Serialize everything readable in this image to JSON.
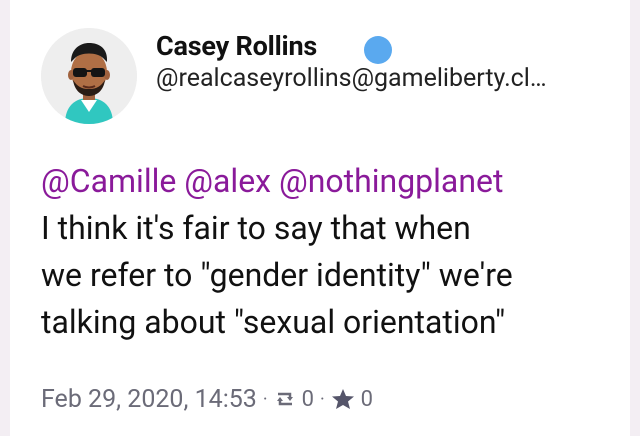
{
  "post": {
    "author": {
      "name": "Casey Rollins",
      "handle": "@realcaseyrollins@gameliberty.cl…",
      "avatar_icon": "bitmoji-avatar-icon",
      "verified_icon": "verified-badge-icon"
    },
    "mentions": [
      "@Camille",
      "@alex",
      "@nothingplanet"
    ],
    "body_lines": [
      "I think it's fair to say that when",
      "we refer to \"gender identity\" we're",
      "talking about \"sexual orientation\""
    ],
    "meta": {
      "timestamp": "Feb 29, 2020, 14:53",
      "separator": "·",
      "repost_icon": "repeat-icon",
      "repost_count": "0",
      "favorite_icon": "star-icon",
      "favorite_count": "0"
    }
  },
  "colors": {
    "mention": "#8a1a9a",
    "verified": "#5aa9ef",
    "meta_text": "#6b6b78",
    "background": "#f3eef3"
  }
}
